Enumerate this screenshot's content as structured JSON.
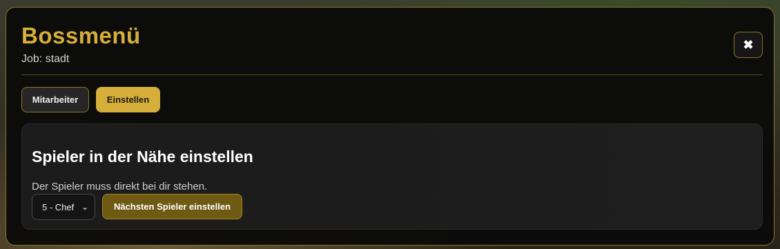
{
  "header": {
    "title": "Bossmenü",
    "subtitle": "Job: stadt",
    "close_icon": "✖"
  },
  "tabs": [
    {
      "label": "Mitarbeiter",
      "active": false
    },
    {
      "label": "Einstellen",
      "active": true
    }
  ],
  "hire_section": {
    "title": "Spieler in der Nähe einstellen",
    "description": "Der Spieler muss direkt bei dir stehen.",
    "grade_select": {
      "selected": "5 - Chef",
      "chevron": "⌄"
    },
    "submit_label": "Nächsten Spieler einstellen"
  },
  "colors": {
    "accent": "#d6ae3a",
    "panel_bg": "#0a0a0a",
    "border": "#8a7428"
  }
}
